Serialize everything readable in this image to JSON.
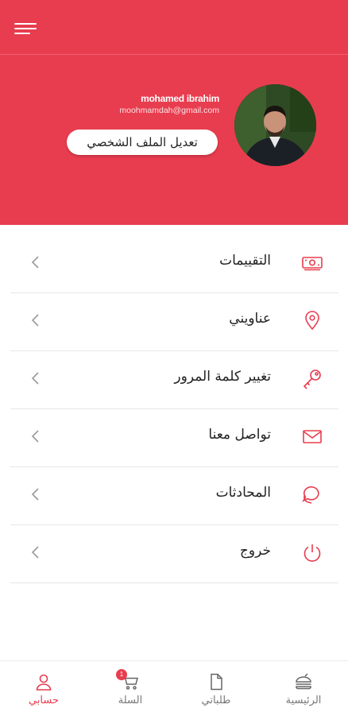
{
  "profile": {
    "name": "mohamed ibrahim",
    "email": "moohmamdah@gmail.com",
    "edit_label": "تعديل الملف الشخصي"
  },
  "menu": [
    {
      "label": "التقييمات",
      "icon": "money-icon"
    },
    {
      "label": "عناويني",
      "icon": "location-pin-icon"
    },
    {
      "label": "تغيير كلمة المرور",
      "icon": "key-icon"
    },
    {
      "label": "تواصل معنا",
      "icon": "mail-icon"
    },
    {
      "label": "المحادثات",
      "icon": "chat-bubble-icon"
    },
    {
      "label": "خروج",
      "icon": "power-icon"
    }
  ],
  "bottom_nav": [
    {
      "label": "الرئيسية",
      "icon": "home-burger-icon",
      "active": false
    },
    {
      "label": "طلباتي",
      "icon": "orders-document-icon",
      "active": false
    },
    {
      "label": "السلة",
      "icon": "cart-icon",
      "active": false,
      "badge": "1"
    },
    {
      "label": "حسابي",
      "icon": "user-icon",
      "active": true
    }
  ],
  "colors": {
    "brand": "#e83d4f",
    "inactive": "#777777"
  }
}
